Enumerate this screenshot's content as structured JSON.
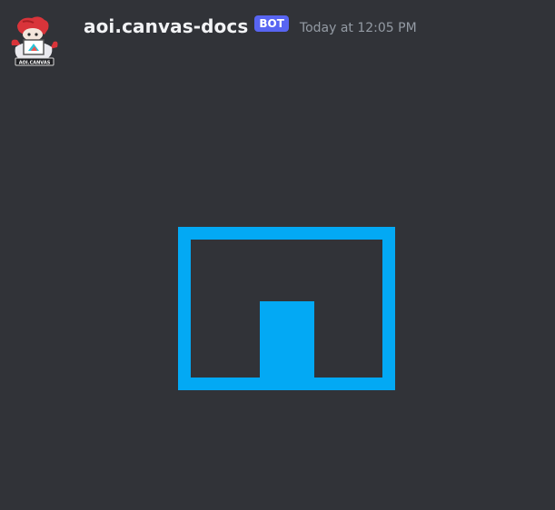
{
  "message": {
    "author": {
      "name": "aoi.canvas-docs",
      "badge": "BOT",
      "avatar_text": "AOI.CANVAS"
    },
    "timestamp": "Today at 12:05 PM",
    "attachment": {
      "type": "canvas-image",
      "fill_color": "#03a9f4",
      "background_color": "#313338"
    }
  },
  "colors": {
    "background": "#313338",
    "username": "#f2f3f5",
    "badge": "#5865f2",
    "timestamp": "#949ba4",
    "accent": "#03a9f4"
  }
}
